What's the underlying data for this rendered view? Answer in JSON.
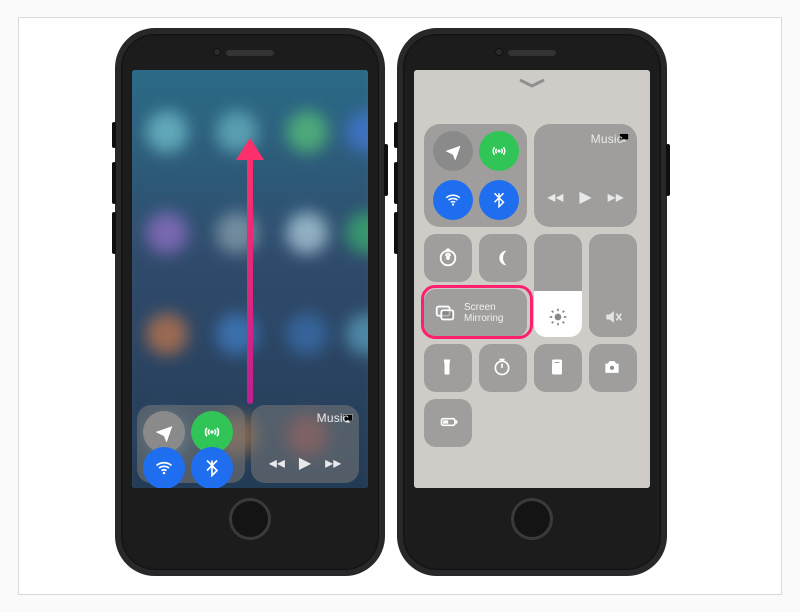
{
  "left": {
    "music_label": "Music",
    "connectivity": {
      "airplane": "airplane-icon",
      "cellular": "cellular-icon",
      "wifi": "wifi-icon",
      "bluetooth": "bluetooth-icon",
      "airplane_on": false,
      "cellular_on": true,
      "wifi_on": true,
      "bluetooth_on": true
    }
  },
  "right": {
    "music_label": "Music",
    "connectivity": {
      "airplane_on": false,
      "cellular_on": true,
      "wifi_on": true,
      "bluetooth_on": true
    },
    "screen_mirroring_label": "Screen\nMirroring",
    "brightness_percent": 45,
    "volume_percent": 0,
    "tiles": [
      "orientation-lock",
      "do-not-disturb",
      "screen-mirroring",
      "brightness",
      "volume",
      "flashlight",
      "timer",
      "calculator",
      "camera",
      "low-power"
    ]
  },
  "colors": {
    "accent_pink": "#ff1f6f",
    "toggle_green": "#31c557",
    "toggle_blue": "#1f6ef0",
    "toggle_gray": "#8a8a8a",
    "tile_bg": "rgba(120,120,120,.55)"
  }
}
